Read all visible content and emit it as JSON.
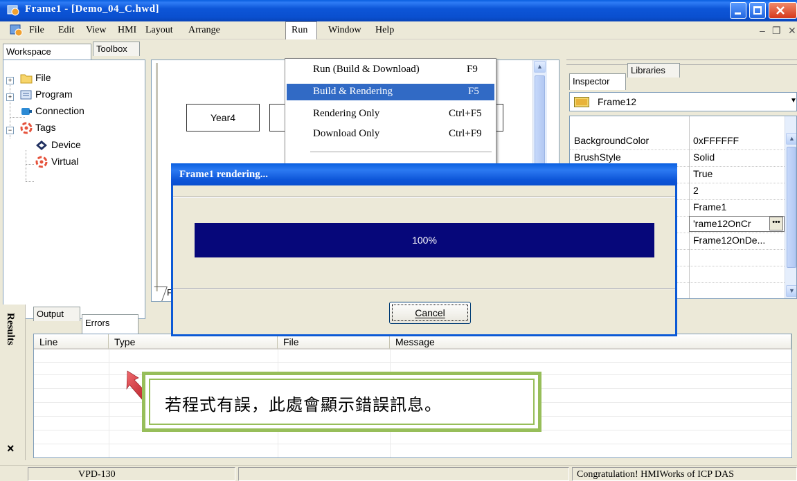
{
  "window": {
    "title": "Frame1 - [Demo_04_C.hwd]"
  },
  "menu": [
    "File",
    "Edit",
    "View",
    "HMI",
    "Layout",
    "Arrange",
    "Run",
    "Window",
    "Help"
  ],
  "mdi_controls": {
    "minimize": "–",
    "restore": "❐",
    "close": "✕"
  },
  "workspace": {
    "tabs": [
      "Workspace",
      "Toolbox"
    ],
    "tree": [
      {
        "label": "File",
        "icon": "folder-icon",
        "expander": "+"
      },
      {
        "label": "Program",
        "icon": "program-icon",
        "expander": "+"
      },
      {
        "label": "Connection",
        "icon": "connection-icon"
      },
      {
        "label": "Tags",
        "icon": "tags-icon",
        "expander": "−"
      },
      {
        "label": "Device",
        "icon": "device-icon"
      },
      {
        "label": "Virtual",
        "icon": "virtual-icon"
      }
    ]
  },
  "design": {
    "widgets": [
      "Year4"
    ],
    "frame_tab_partial": "F"
  },
  "run_menu": {
    "items": [
      {
        "label": "Run (Build & Download)",
        "shortcut": "F9"
      },
      {
        "label": "Build & Rendering",
        "shortcut": "F5",
        "selected": true
      },
      {
        "label": "Rendering Only",
        "shortcut": "Ctrl+F5"
      },
      {
        "label": "Download Only",
        "shortcut": "Ctrl+F9"
      }
    ]
  },
  "inspector": {
    "tabs": [
      "Inspector",
      "Libraries"
    ],
    "selected_object": "Frame12",
    "properties": [
      {
        "name": "BackgroundColor",
        "value": "0xFFFFFF"
      },
      {
        "name": "BrushStyle",
        "value": "Solid"
      },
      {
        "name": "",
        "value": "True"
      },
      {
        "name": "",
        "value": "2"
      },
      {
        "name": "",
        "value": "Frame1"
      },
      {
        "name": "",
        "value": "'rame12OnCr"
      },
      {
        "name": "",
        "value": "Frame12OnDe..."
      },
      {
        "name": "",
        "value": ""
      },
      {
        "name": "",
        "value": ""
      }
    ]
  },
  "dialog": {
    "title": "Frame1 rendering...",
    "progress_text": "100%",
    "progress_value": 1.0,
    "cancel_label": "Cancel"
  },
  "results": {
    "side_label": "Results",
    "tabs": [
      "Output",
      "Errors"
    ],
    "columns": [
      "Line",
      "Type",
      "File",
      "Message"
    ],
    "close_glyph": "×"
  },
  "annotation": {
    "text": "若程式有誤，此處會顯示錯誤訊息。"
  },
  "status": {
    "left": "VPD-130",
    "right": "Congratulation! HMIWorks of ICP DAS"
  },
  "colors": {
    "titlebar": "#0A4FCF",
    "menu_highlight": "#316AC5",
    "progress": "#06077A",
    "annotation_border": "#97BE5A",
    "arrow": "#E0454A"
  }
}
